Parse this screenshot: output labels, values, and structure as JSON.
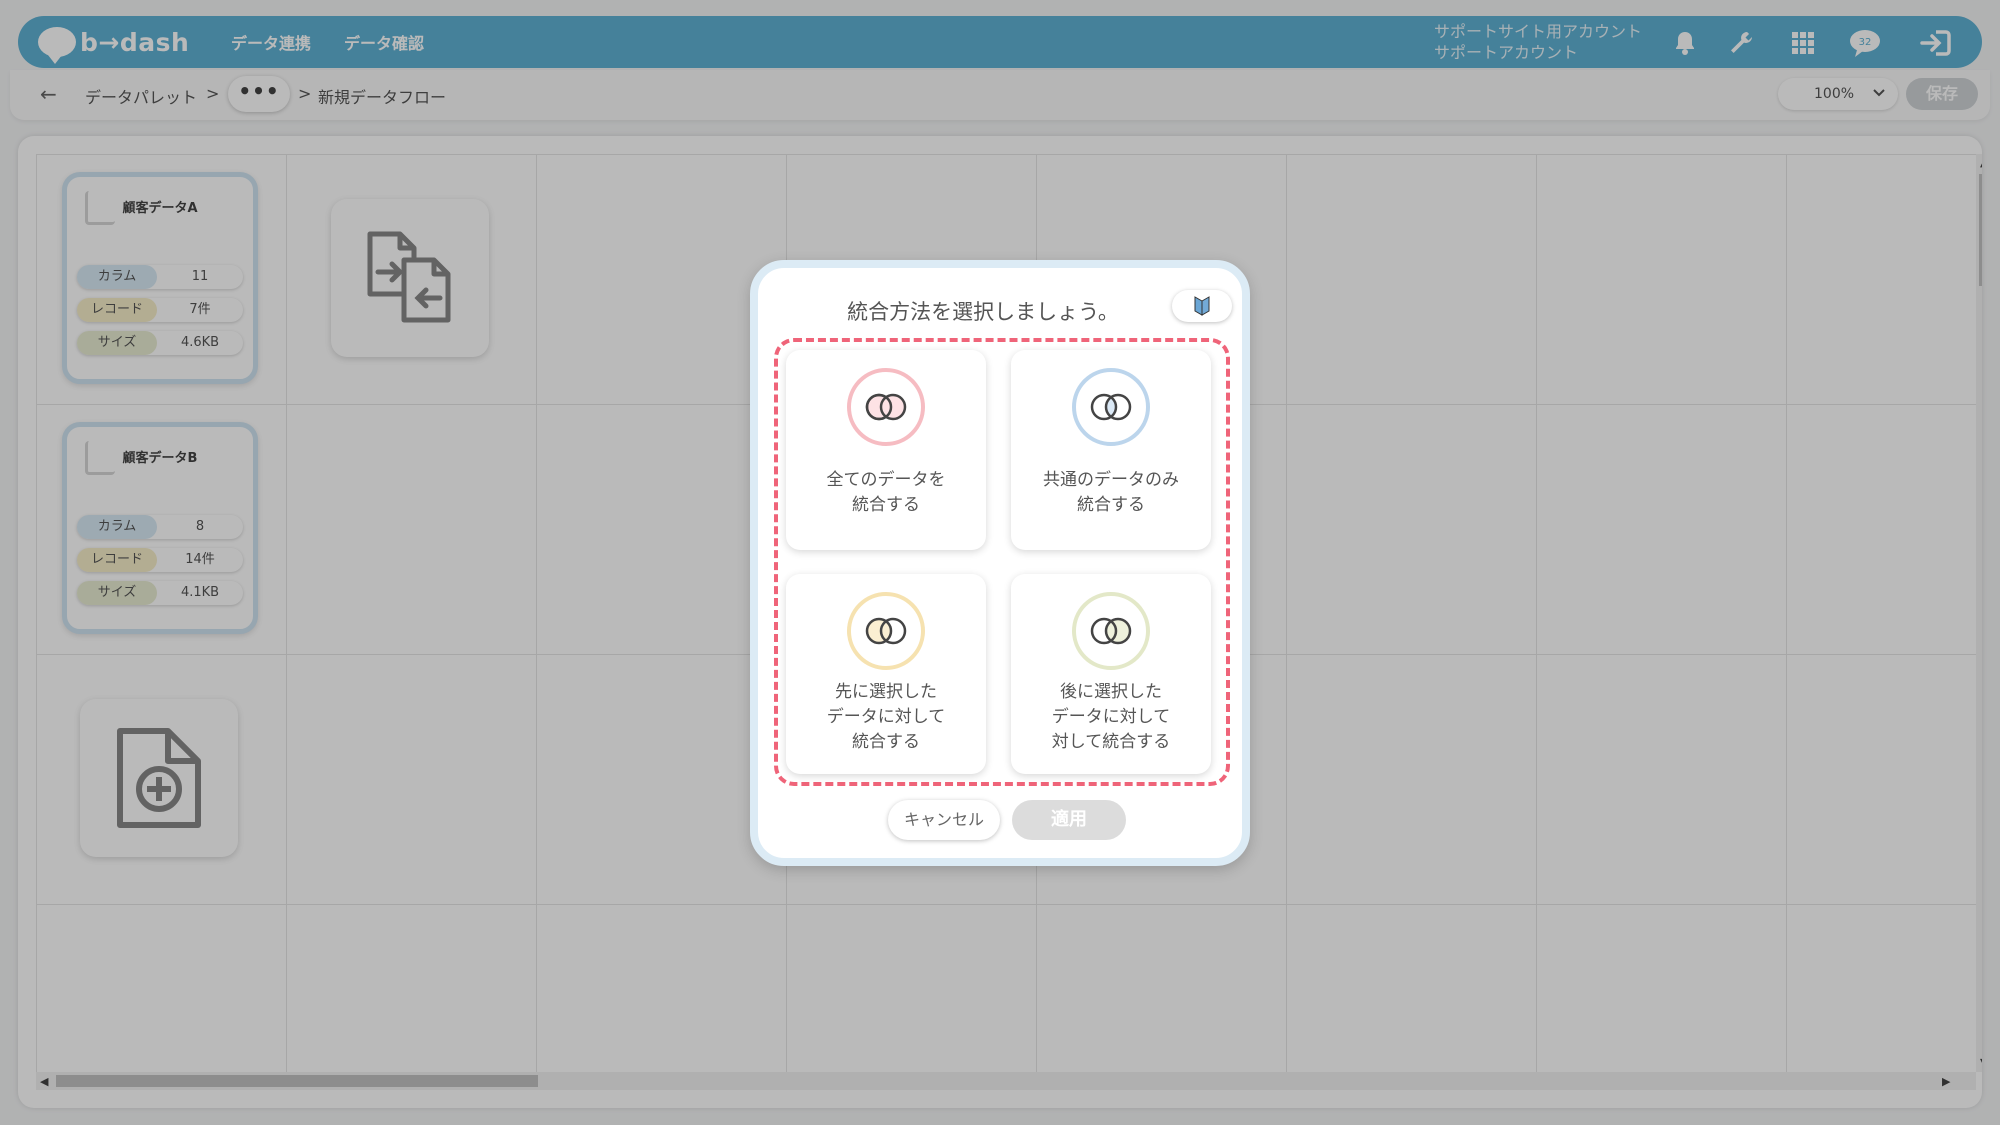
{
  "header": {
    "logo_text": "b→dash",
    "nav": [
      "データ連携",
      "データ確認"
    ],
    "account_line1": "サポートサイト用アカウント",
    "account_line2": "サポートアカウント",
    "icons": [
      "bell-icon",
      "wrench-icon",
      "apps-grid-icon",
      "chat-badge-icon",
      "logout-icon"
    ],
    "badge_count": "32"
  },
  "toolbar": {
    "back_icon": "←",
    "crumb_root": "データパレット",
    "separator": ">",
    "more_label": "•••",
    "crumb_current": "新規データフロー",
    "zoom_value": "100%",
    "save_label": "保存"
  },
  "canvas": {
    "cards": [
      {
        "title": "顧客データA",
        "stats": [
          {
            "label": "カラム",
            "value": "11",
            "color": "#d7e9f5"
          },
          {
            "label": "レコード",
            "value": "7件",
            "color": "#f6edc9"
          },
          {
            "label": "サイズ",
            "value": "4.6KB",
            "color": "#e8ecd2"
          }
        ]
      },
      {
        "title": "顧客データB",
        "stats": [
          {
            "label": "カラム",
            "value": "8",
            "color": "#d7e9f5"
          },
          {
            "label": "レコード",
            "value": "14件",
            "color": "#f6edc9"
          },
          {
            "label": "サイズ",
            "value": "4.1KB",
            "color": "#e8ecd2"
          }
        ]
      }
    ]
  },
  "modal": {
    "title": "統合方法を選択しましょう。",
    "options": [
      {
        "label": "全てのデータを\n統合する",
        "ring_color": "#f6bcc2",
        "fill_color": "#fde2e5"
      },
      {
        "label": "共通のデータのみ\n統合する",
        "ring_color": "#bcd5ec",
        "fill_color": "#dbe9f6"
      },
      {
        "label": "先に選択した\nデータに対して\n統合する",
        "ring_color": "#f6e2b0",
        "fill_color": "#fbefd2"
      },
      {
        "label": "後に選択した\nデータに対して\n対して統合する",
        "ring_color": "#e3e8c8",
        "fill_color": "#eef1dc"
      }
    ],
    "cancel_label": "キャンセル",
    "apply_label": "適用"
  },
  "colors": {
    "header_bg": "#5fb1d3",
    "dash_border": "#ef6479",
    "modal_border": "#dcebf5"
  }
}
